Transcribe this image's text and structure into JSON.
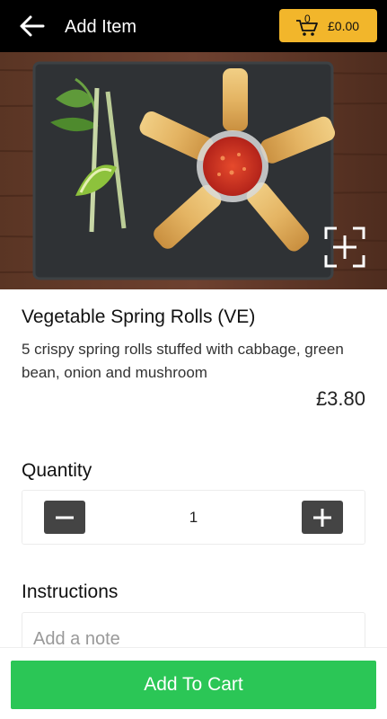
{
  "header": {
    "title": "Add Item",
    "back_icon": "arrow-left-icon",
    "cart": {
      "icon": "shopping-cart-icon",
      "count": "0",
      "total": "£0.00",
      "color": "#f2b62b"
    }
  },
  "hero": {
    "alt": "Vegetable Spring Rolls (VE)",
    "expand_icon": "expand-icon"
  },
  "item": {
    "name": "Vegetable Spring Rolls (VE)",
    "description": "5 crispy spring rolls stuffed with cabbage, green bean, onion and mushroom",
    "price": "£3.80"
  },
  "quantity": {
    "label": "Quantity",
    "value": "1",
    "minus_icon": "minus-icon",
    "plus_icon": "plus-icon"
  },
  "instructions": {
    "label": "Instructions",
    "placeholder": "Add a note",
    "value": ""
  },
  "footer": {
    "add_button_label": "Add To Cart",
    "color": "#2bc656"
  }
}
